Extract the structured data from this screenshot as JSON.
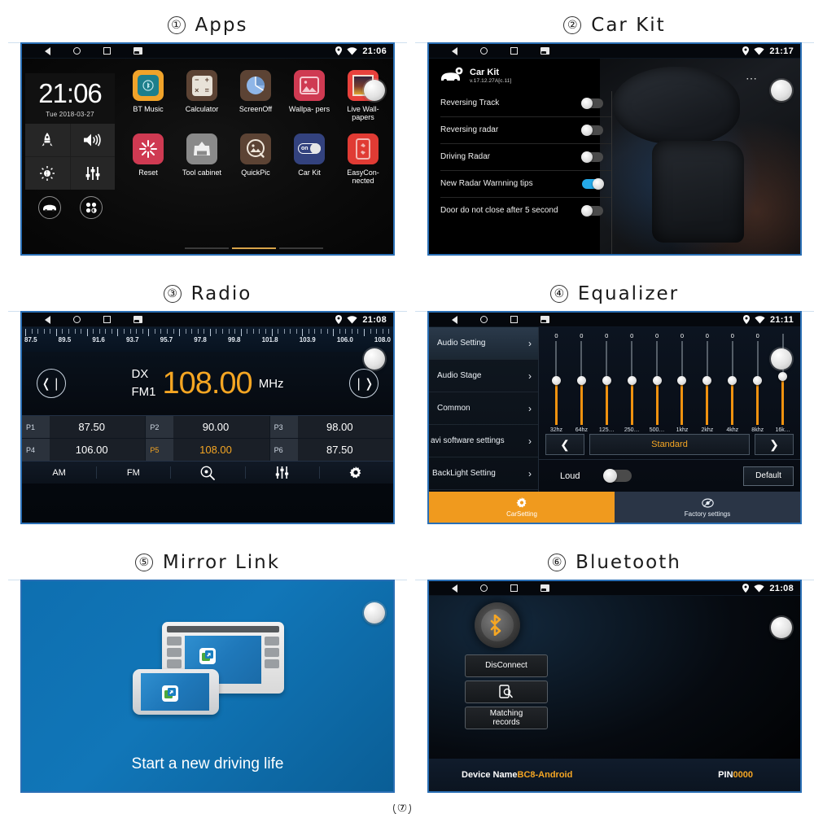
{
  "panels": [
    {
      "number": "①",
      "title": "Apps"
    },
    {
      "number": "②",
      "title": "Car Kit"
    },
    {
      "number": "③",
      "title": "Radio"
    },
    {
      "number": "④",
      "title": "Equalizer"
    },
    {
      "number": "⑤",
      "title": "Mirror Link"
    },
    {
      "number": "⑥",
      "title": "Bluetooth"
    },
    {
      "number": "⑦",
      "title": ""
    }
  ],
  "statusbar": {
    "back_icon": "back-triangle-icon",
    "home_icon": "home-circle-icon",
    "recent_icon": "recent-square-icon",
    "screenshot_icon": "screenshot-icon",
    "location_icon": "location-pin-icon",
    "wifi_icon": "wifi-icon",
    "times": {
      "apps": "21:06",
      "car_kit": "21:17",
      "radio": "21:08",
      "equalizer": "21:11",
      "bluetooth": "21:08"
    }
  },
  "apps": {
    "widget": {
      "time": "21:06",
      "date": "Tue  2018-03-27",
      "tiles": [
        {
          "icon": "rocket-icon"
        },
        {
          "icon": "volume-icon"
        },
        {
          "icon": "brightness-icon"
        },
        {
          "icon": "equalizer-sliders-icon"
        }
      ],
      "round_buttons": [
        {
          "icon": "car-icon"
        },
        {
          "icon": "apps-grid-icon"
        }
      ]
    },
    "row1": [
      {
        "label": "BT Music",
        "icon": "bt-music-icon",
        "bg": "#f0a32a",
        "inner": "#1d7f8c"
      },
      {
        "label": "Calculator",
        "icon": "calculator-icon",
        "bg": "#5c4334",
        "inner": "#e8e2d8"
      },
      {
        "label": "ScreenOff",
        "icon": "screen-off-pie-icon",
        "bg": "#5c4334",
        "inner": "#8fb6e8"
      },
      {
        "label": "Wallpa-\npers",
        "icon": "wallpapers-icon",
        "bg": "#cf3a52",
        "inner": "#f6c8d0"
      },
      {
        "label": "Live Wall-\npapers",
        "icon": "live-wallpapers-icon",
        "bg": "#e8413c",
        "inner": "#2a1d2f"
      }
    ],
    "row2": [
      {
        "label": "Reset",
        "icon": "reset-burst-icon",
        "bg": "#cf3a52",
        "inner": "#ffffff"
      },
      {
        "label": "Tool\ncabinet",
        "icon": "tool-cabinet-icon",
        "bg": "#8a8a8a",
        "inner": "#efefef"
      },
      {
        "label": "QuickPic",
        "icon": "quickpic-icon",
        "bg": "#5c4334",
        "inner": "#efe6da"
      },
      {
        "label": "Car Kit",
        "icon": "car-kit-toggle-icon",
        "bg": "#33427e",
        "inner": "#ffffff"
      },
      {
        "label": "EasyCon-\nnected",
        "icon": "easyconnected-icon",
        "bg": "#e03b34",
        "inner": "#f3b8b4"
      }
    ],
    "page_dots": {
      "count": 3,
      "active_index": 1
    }
  },
  "car_kit": {
    "header_icon": "car-gear-icon",
    "title": "Car Kit",
    "version": "v.17.12.27A[c.11]",
    "overflow_icon": "more-options-icon",
    "items": [
      {
        "label": "Reversing Track",
        "state": "off"
      },
      {
        "label": "Reversing radar",
        "state": "off"
      },
      {
        "label": "Driving Radar",
        "state": "off"
      },
      {
        "label": "New Radar Warnning tips",
        "state": "on"
      },
      {
        "label": "Door do not close after 5 second",
        "state": "off"
      }
    ]
  },
  "radio": {
    "scale_labels": [
      "87.5",
      "89.5",
      "91.6",
      "93.7",
      "95.7",
      "97.8",
      "99.8",
      "101.8",
      "103.9",
      "106.0",
      "108.0"
    ],
    "prev_icon": "prev-station-icon",
    "next_icon": "next-station-icon",
    "sensitivity": "DX",
    "band": "FM1",
    "frequency": "108.00",
    "unit": "MHz",
    "presets": [
      {
        "tag": "P1",
        "value": "87.50",
        "active": false
      },
      {
        "tag": "P2",
        "value": "90.00",
        "active": false
      },
      {
        "tag": "P3",
        "value": "98.00",
        "active": false
      },
      {
        "tag": "P4",
        "value": "106.00",
        "active": false
      },
      {
        "tag": "P5",
        "value": "108.00",
        "active": true
      },
      {
        "tag": "P6",
        "value": "87.50",
        "active": false
      }
    ],
    "tabs": [
      {
        "label": "AM",
        "icon": ""
      },
      {
        "label": "FM",
        "icon": ""
      },
      {
        "label": "",
        "icon": "scan-search-icon"
      },
      {
        "label": "",
        "icon": "equalizer-sliders-icon"
      },
      {
        "label": "",
        "icon": "gear-icon"
      }
    ]
  },
  "equalizer": {
    "sidebar": [
      {
        "label": "Audio Setting",
        "selected": true
      },
      {
        "label": "Audio Stage",
        "selected": false
      },
      {
        "label": "Common",
        "selected": false
      },
      {
        "label": "avi software settings",
        "selected": false
      },
      {
        "label": "BackLight Setting",
        "selected": false
      }
    ],
    "bands": [
      {
        "label": "32hz",
        "value": "0"
      },
      {
        "label": "64hz",
        "value": "0"
      },
      {
        "label": "125…",
        "value": "0"
      },
      {
        "label": "250…",
        "value": "0"
      },
      {
        "label": "500…",
        "value": "0"
      },
      {
        "label": "1khz",
        "value": "0"
      },
      {
        "label": "2khz",
        "value": "0"
      },
      {
        "label": "4khz",
        "value": "0"
      },
      {
        "label": "8khz",
        "value": "0"
      },
      {
        "label": "16k…",
        "value": ""
      }
    ],
    "preset_prev_icon": "chevron-left-icon",
    "preset_next_icon": "chevron-right-icon",
    "preset_name": "Standard",
    "loud_label": "Loud",
    "loud_state": "off",
    "default_label": "Default",
    "tabs": [
      {
        "label": "CarSetting",
        "icon": "carsetting-gear-icon",
        "active": true
      },
      {
        "label": "Factory settings",
        "icon": "factory-settings-icon",
        "active": false
      }
    ]
  },
  "mirror_link": {
    "tagline": "Start a new driving life",
    "headunit_icon": "car-headunit-icon",
    "phone_icon": "smartphone-icon",
    "badge_icon": "mirror-link-badge-icon"
  },
  "bluetooth": {
    "bt_icon": "bluetooth-icon",
    "buttons": [
      {
        "label": "DisConnect",
        "icon": ""
      },
      {
        "label": "",
        "icon": "search-device-icon"
      },
      {
        "label": "Matching\nrecords",
        "icon": ""
      }
    ],
    "device_name_label": "Device Name",
    "device_name_value": "BC8-Android",
    "pin_label": "PIN",
    "pin_value": "0000"
  },
  "colors": {
    "accent_orange": "#f5a623",
    "accent_blue": "#25a9e8",
    "screen_border": "#2a6fb5",
    "mirror_bg": "#0e6fb0"
  }
}
